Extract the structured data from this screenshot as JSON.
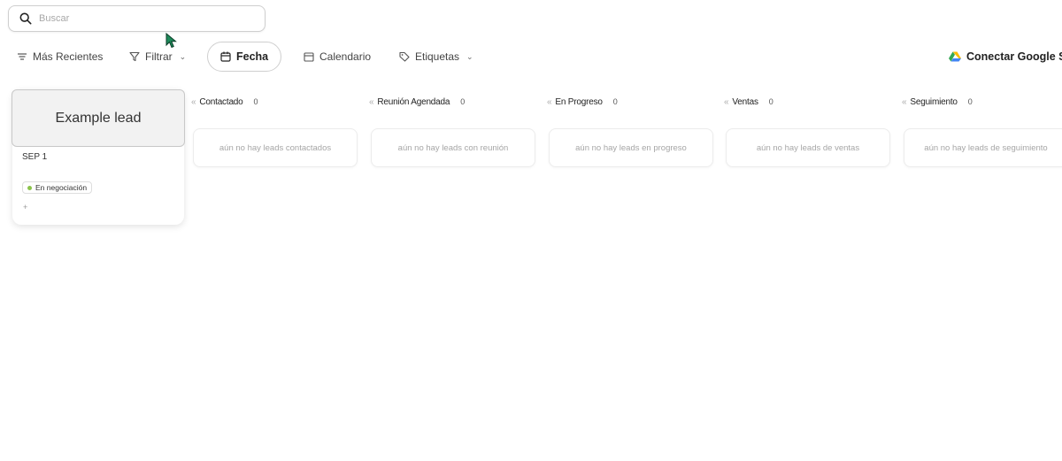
{
  "search": {
    "placeholder": "Buscar",
    "value": ""
  },
  "toolbar": {
    "recent_label": "Más Recientes",
    "filter_label": "Filtrar",
    "date_label": "Fecha",
    "calendar_label": "Calendario",
    "tags_label": "Etiquetas",
    "google_label": "Conectar Google Sh"
  },
  "lead": {
    "title": "Example lead",
    "date": "SEP 1",
    "status": "En negociación",
    "status_color": "#8bc34a",
    "add": "+"
  },
  "columns": [
    {
      "title": "Contactado",
      "count": "0",
      "empty": "aún no hay leads contactados"
    },
    {
      "title": "Reunión Agendada",
      "count": "0",
      "empty": "aún no hay leads con reunión"
    },
    {
      "title": "En Progreso",
      "count": "0",
      "empty": "aún no hay leads en progreso"
    },
    {
      "title": "Ventas",
      "count": "0",
      "empty": "aún no hay leads de ventas"
    },
    {
      "title": "Seguimiento",
      "count": "0",
      "empty": "aún no hay leads de seguimiento"
    }
  ],
  "colors": {
    "accent_green": "#8bc34a",
    "cursor_green": "#1e8a5a"
  }
}
